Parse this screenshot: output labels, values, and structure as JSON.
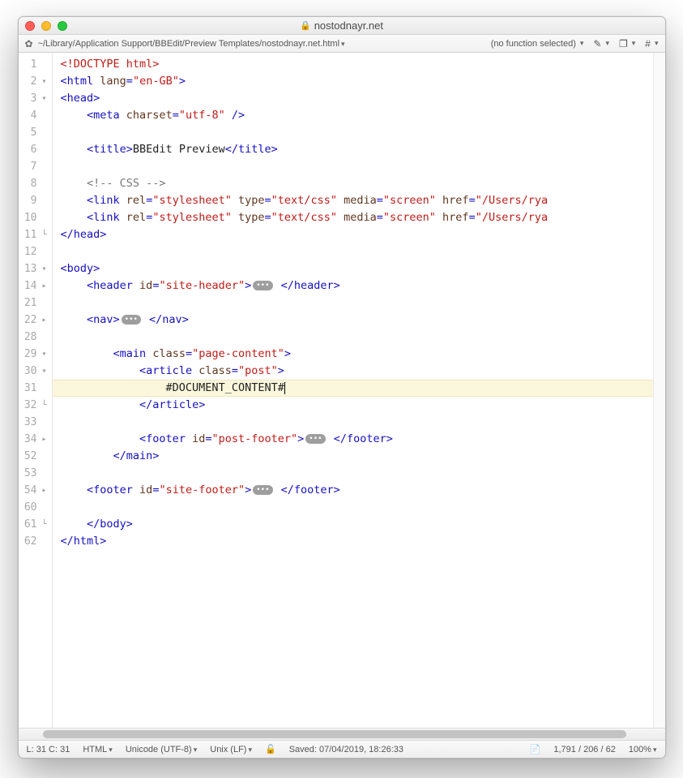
{
  "window": {
    "title": "nostodnayr.net"
  },
  "navbar": {
    "path": "~/Library/Application Support/BBEdit/Preview Templates/nostodnayr.net.html",
    "function_menu": "(no function selected)"
  },
  "code": {
    "lines": [
      {
        "n": "1",
        "fold": "",
        "segs": [
          [
            "doctype",
            "<!DOCTYPE html>"
          ]
        ]
      },
      {
        "n": "2",
        "fold": "▾",
        "segs": [
          [
            "tag",
            "<html "
          ],
          [
            "attr",
            "lang"
          ],
          [
            "tag",
            "="
          ],
          [
            "val",
            "\"en-GB\""
          ],
          [
            "tag",
            ">"
          ]
        ]
      },
      {
        "n": "3",
        "fold": "▾",
        "segs": [
          [
            "tag",
            "<head>"
          ]
        ]
      },
      {
        "n": "4",
        "fold": "",
        "segs": [
          [
            "txt",
            "    "
          ],
          [
            "tag",
            "<meta "
          ],
          [
            "attr",
            "charset"
          ],
          [
            "tag",
            "="
          ],
          [
            "val",
            "\"utf-8\""
          ],
          [
            "tag",
            " />"
          ]
        ]
      },
      {
        "n": "5",
        "fold": "",
        "segs": []
      },
      {
        "n": "6",
        "fold": "",
        "segs": [
          [
            "txt",
            "    "
          ],
          [
            "tag",
            "<title>"
          ],
          [
            "txt",
            "BBEdit Preview"
          ],
          [
            "tag",
            "</title>"
          ]
        ]
      },
      {
        "n": "7",
        "fold": "",
        "segs": []
      },
      {
        "n": "8",
        "fold": "",
        "segs": [
          [
            "txt",
            "    "
          ],
          [
            "cmt",
            "<!-- CSS -->"
          ]
        ]
      },
      {
        "n": "9",
        "fold": "",
        "segs": [
          [
            "txt",
            "    "
          ],
          [
            "tag",
            "<link "
          ],
          [
            "attr",
            "rel"
          ],
          [
            "tag",
            "="
          ],
          [
            "val",
            "\"stylesheet\""
          ],
          [
            "tag",
            " "
          ],
          [
            "attr",
            "type"
          ],
          [
            "tag",
            "="
          ],
          [
            "val",
            "\"text/css\""
          ],
          [
            "tag",
            " "
          ],
          [
            "attr",
            "media"
          ],
          [
            "tag",
            "="
          ],
          [
            "val",
            "\"screen\""
          ],
          [
            "tag",
            " "
          ],
          [
            "attr",
            "href"
          ],
          [
            "tag",
            "="
          ],
          [
            "val",
            "\"/Users/rya"
          ]
        ]
      },
      {
        "n": "10",
        "fold": "",
        "segs": [
          [
            "txt",
            "    "
          ],
          [
            "tag",
            "<link "
          ],
          [
            "attr",
            "rel"
          ],
          [
            "tag",
            "="
          ],
          [
            "val",
            "\"stylesheet\""
          ],
          [
            "tag",
            " "
          ],
          [
            "attr",
            "type"
          ],
          [
            "tag",
            "="
          ],
          [
            "val",
            "\"text/css\""
          ],
          [
            "tag",
            " "
          ],
          [
            "attr",
            "media"
          ],
          [
            "tag",
            "="
          ],
          [
            "val",
            "\"screen\""
          ],
          [
            "tag",
            " "
          ],
          [
            "attr",
            "href"
          ],
          [
            "tag",
            "="
          ],
          [
            "val",
            "\"/Users/rya"
          ]
        ]
      },
      {
        "n": "11",
        "fold": "▴",
        "segs": [
          [
            "tag",
            "</head>"
          ]
        ]
      },
      {
        "n": "12",
        "fold": "",
        "segs": []
      },
      {
        "n": "13",
        "fold": "▾",
        "segs": [
          [
            "tag",
            "<body>"
          ]
        ]
      },
      {
        "n": "14",
        "fold": "▸",
        "segs": [
          [
            "txt",
            "    "
          ],
          [
            "tag",
            "<header "
          ],
          [
            "attr",
            "id"
          ],
          [
            "tag",
            "="
          ],
          [
            "val",
            "\"site-header\""
          ],
          [
            "tag",
            ">"
          ],
          [
            "pill",
            "•••"
          ],
          [
            "tag",
            " </header>"
          ]
        ]
      },
      {
        "n": "21",
        "fold": "",
        "segs": []
      },
      {
        "n": "22",
        "fold": "▸",
        "segs": [
          [
            "txt",
            "    "
          ],
          [
            "tag",
            "<nav>"
          ],
          [
            "pill",
            "•••"
          ],
          [
            "tag",
            " </nav>"
          ]
        ]
      },
      {
        "n": "28",
        "fold": "",
        "segs": []
      },
      {
        "n": "29",
        "fold": "▾",
        "segs": [
          [
            "txt",
            "        "
          ],
          [
            "tag",
            "<main "
          ],
          [
            "attr",
            "class"
          ],
          [
            "tag",
            "="
          ],
          [
            "val",
            "\"page-content\""
          ],
          [
            "tag",
            ">"
          ]
        ]
      },
      {
        "n": "30",
        "fold": "▾",
        "segs": [
          [
            "txt",
            "            "
          ],
          [
            "tag",
            "<article "
          ],
          [
            "attr",
            "class"
          ],
          [
            "tag",
            "="
          ],
          [
            "val",
            "\"post\""
          ],
          [
            "tag",
            ">"
          ]
        ]
      },
      {
        "n": "31",
        "fold": "",
        "hl": true,
        "segs": [
          [
            "txt",
            "                #DOCUMENT_CONTENT#"
          ],
          [
            "cursor",
            ""
          ]
        ]
      },
      {
        "n": "32",
        "fold": "▴",
        "segs": [
          [
            "txt",
            "            "
          ],
          [
            "tag",
            "</article>"
          ]
        ]
      },
      {
        "n": "33",
        "fold": "",
        "segs": []
      },
      {
        "n": "34",
        "fold": "▸",
        "segs": [
          [
            "txt",
            "            "
          ],
          [
            "tag",
            "<footer "
          ],
          [
            "attr",
            "id"
          ],
          [
            "tag",
            "="
          ],
          [
            "val",
            "\"post-footer\""
          ],
          [
            "tag",
            ">"
          ],
          [
            "pill",
            "•••"
          ],
          [
            "tag",
            " </footer>"
          ]
        ]
      },
      {
        "n": "52",
        "fold": "",
        "segs": [
          [
            "txt",
            "        "
          ],
          [
            "tag",
            "</main>"
          ]
        ]
      },
      {
        "n": "53",
        "fold": "",
        "segs": []
      },
      {
        "n": "54",
        "fold": "▸",
        "segs": [
          [
            "txt",
            "    "
          ],
          [
            "tag",
            "<footer "
          ],
          [
            "attr",
            "id"
          ],
          [
            "tag",
            "="
          ],
          [
            "val",
            "\"site-footer\""
          ],
          [
            "tag",
            ">"
          ],
          [
            "pill",
            "•••"
          ],
          [
            "tag",
            " </footer>"
          ]
        ]
      },
      {
        "n": "60",
        "fold": "",
        "segs": []
      },
      {
        "n": "61",
        "fold": "▴",
        "segs": [
          [
            "txt",
            "    "
          ],
          [
            "tag",
            "</body>"
          ]
        ]
      },
      {
        "n": "62",
        "fold": "",
        "segs": [
          [
            "tag",
            "</html>"
          ]
        ]
      }
    ]
  },
  "status": {
    "cursor": "L: 31 C: 31",
    "language": "HTML",
    "encoding": "Unicode (UTF-8)",
    "lineending": "Unix (LF)",
    "saved": "Saved: 07/04/2019, 18:26:33",
    "counts": "1,791 / 206 / 62",
    "zoom": "100%"
  }
}
